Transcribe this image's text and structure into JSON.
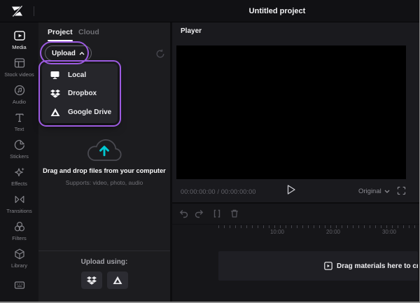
{
  "topbar": {
    "title": "Untitled project"
  },
  "sidebar": {
    "items": [
      {
        "label": "Media",
        "icon": "media-icon",
        "active": true
      },
      {
        "label": "Stock videos",
        "icon": "stock-videos-icon",
        "active": false
      },
      {
        "label": "Audio",
        "icon": "audio-icon",
        "active": false
      },
      {
        "label": "Text",
        "icon": "text-icon",
        "active": false
      },
      {
        "label": "Stickers",
        "icon": "stickers-icon",
        "active": false
      },
      {
        "label": "Effects",
        "icon": "effects-icon",
        "active": false
      },
      {
        "label": "Transitions",
        "icon": "transitions-icon",
        "active": false
      },
      {
        "label": "Filters",
        "icon": "filters-icon",
        "active": false
      },
      {
        "label": "Library",
        "icon": "library-icon",
        "active": false
      },
      {
        "label": "",
        "icon": "shortcuts-icon",
        "active": false
      }
    ]
  },
  "media_panel": {
    "tabs": [
      {
        "label": "Project",
        "active": true
      },
      {
        "label": "Cloud",
        "active": false
      }
    ],
    "upload_button": {
      "label": "Upload",
      "state": "menu-open"
    },
    "upload_menu": {
      "items": [
        {
          "label": "Local",
          "icon": "monitor-icon"
        },
        {
          "label": "Dropbox",
          "icon": "dropbox-icon"
        },
        {
          "label": "Google Drive",
          "icon": "google-drive-icon"
        }
      ]
    },
    "dropzone": {
      "icon": "cloud-upload-icon",
      "title": "Drag and drop files from your computer",
      "subtitle": "Supports: video, photo, audio"
    },
    "footer": {
      "label": "Upload using:",
      "providers": [
        "dropbox",
        "google-drive"
      ]
    }
  },
  "player": {
    "title": "Player",
    "timecode": "00:00:00:00 / 00:00:00:00",
    "ratio": "Original"
  },
  "timeline": {
    "ruler_labels": [
      "10:00",
      "20:00",
      "30:00"
    ],
    "drop_hint": "Drag materials here to create fantas"
  },
  "annotations": {
    "highlight_color": "#9d5be1",
    "highlighted": [
      "upload-button",
      "upload-menu"
    ]
  },
  "colors": {
    "highlight_purple": "#9d5be1",
    "accent_teal": "#00c8d2",
    "background": "#161619"
  }
}
